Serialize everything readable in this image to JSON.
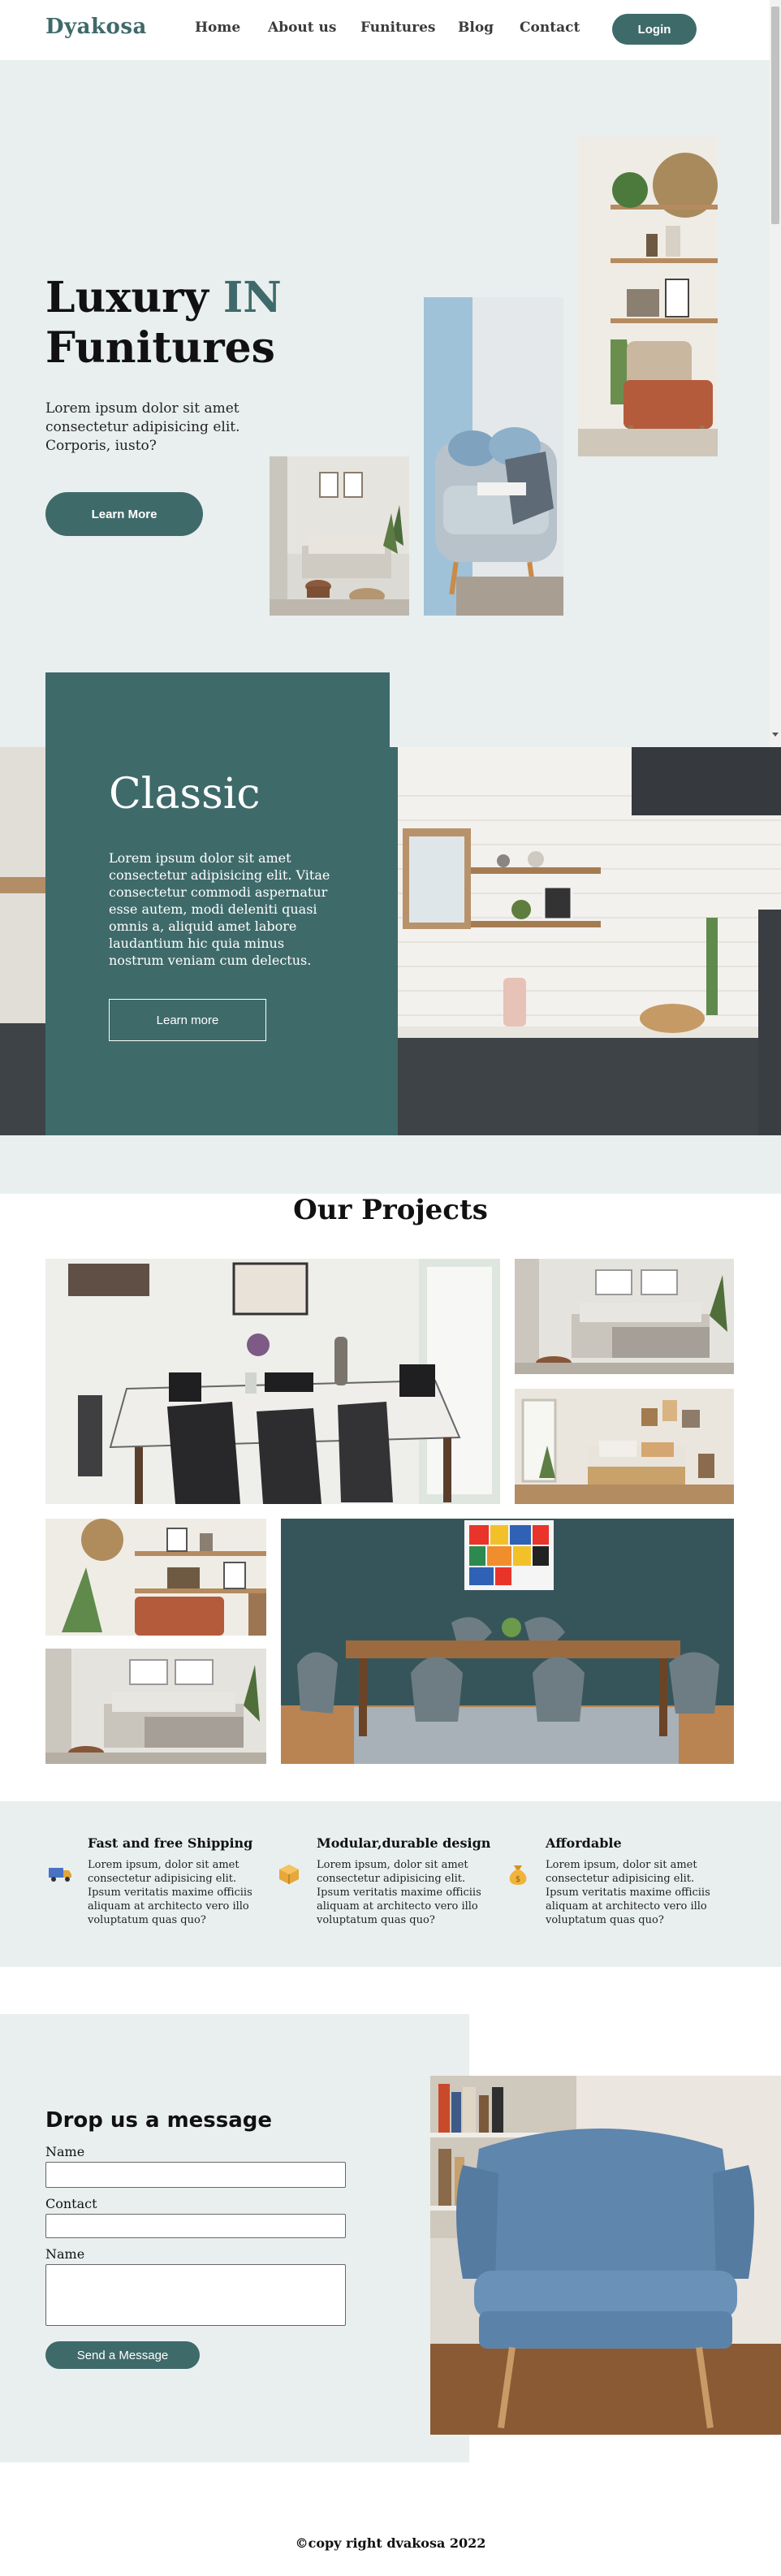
{
  "header": {
    "logo": "Dyakosa",
    "nav": [
      "Home",
      "About us",
      "Funitures",
      "Blog",
      "Contact"
    ],
    "login_label": "Login"
  },
  "hero": {
    "title_part1": "Luxury ",
    "title_accent": "IN",
    "title_line2": "Funitures",
    "description": "Lorem ipsum dolor sit amet consectetur adipisicing elit. Corporis, iusto?",
    "button_label": "Learn More"
  },
  "classic": {
    "title": "Classic",
    "description": "Lorem ipsum dolor sit amet consectetur adipisicing elit. Vitae consectetur commodi aspernatur esse autem, modi deleniti quasi omnis a, aliquid amet labore laudantium hic quia minus nostrum veniam cum delectus.",
    "button_label": "Learn more"
  },
  "projects": {
    "title": "Our Projects"
  },
  "features": [
    {
      "title": "Fast and free Shipping",
      "description": "Lorem ipsum, dolor sit amet consectetur adipisicing elit. Ipsum veritatis maxime officiis aliquam at architecto vero illo voluptatum quas quo?",
      "icon": "truck-icon"
    },
    {
      "title": "Modular,durable design",
      "description": "Lorem ipsum, dolor sit amet consectetur adipisicing elit. Ipsum veritatis maxime officiis aliquam at architecto vero illo voluptatum quas quo?",
      "icon": "box-icon"
    },
    {
      "title": "Affordable",
      "description": "Lorem ipsum, dolor sit amet consectetur adipisicing elit. Ipsum veritatis maxime officiis aliquam at architecto vero illo voluptatum quas quo?",
      "icon": "money-bag-icon"
    }
  ],
  "contact": {
    "title": "Drop us a message",
    "label_name": "Name",
    "label_contact": "Contact",
    "label_message": "Name",
    "button_label": "Send a Message"
  },
  "footer": {
    "text": "©copy right dvakosa 2022"
  },
  "colors": {
    "accent": "#3f6a6a",
    "light_bg": "#e9efef"
  }
}
